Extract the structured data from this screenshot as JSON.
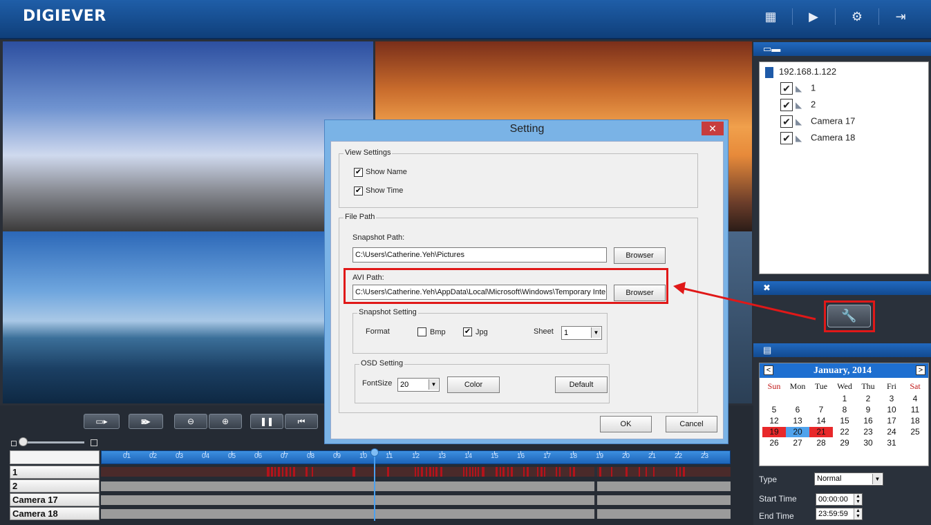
{
  "app": {
    "brand": "DIGIEVER",
    "header_icons": [
      "grid-view-icon",
      "playback-icon",
      "settings-gear-icon",
      "logout-icon"
    ]
  },
  "video": {
    "tiles": [
      "camera-view-1",
      "camera-view-2",
      "camera-view-3",
      "camera-view-4"
    ]
  },
  "controls": {
    "buttons": [
      "record-folder-icon",
      "snapshot-folder-icon",
      "zoom-out-icon",
      "zoom-in-icon",
      "pause-icon",
      "step-back-icon"
    ]
  },
  "timeline": {
    "hours": [
      "01",
      "02",
      "03",
      "04",
      "05",
      "06",
      "07",
      "08",
      "09",
      "10",
      "11",
      "12",
      "13",
      "14",
      "15",
      "16",
      "17",
      "18",
      "19",
      "20",
      "21",
      "22",
      "23"
    ],
    "rows": [
      {
        "label": "1"
      },
      {
        "label": "2"
      },
      {
        "label": "Camera 17"
      },
      {
        "label": "Camera 18"
      }
    ]
  },
  "device_panel": {
    "ip": "192.168.1.122",
    "cameras": [
      {
        "name": "1",
        "checked": "✔"
      },
      {
        "name": "2",
        "checked": "✔"
      },
      {
        "name": "Camera 17",
        "checked": "✔"
      },
      {
        "name": "Camera 18",
        "checked": "✔"
      }
    ]
  },
  "calendar": {
    "month": "January, 2014",
    "prev": "<",
    "next": ">",
    "dow": [
      "Sun",
      "Mon",
      "Tue",
      "Wed",
      "Thu",
      "Fri",
      "Sat"
    ],
    "weeks": [
      [
        "",
        "",
        "",
        "1",
        "2",
        "3",
        "4"
      ],
      [
        "5",
        "6",
        "7",
        "8",
        "9",
        "10",
        "11"
      ],
      [
        "12",
        "13",
        "14",
        "15",
        "16",
        "17",
        "18"
      ],
      [
        "19",
        "20",
        "21",
        "22",
        "23",
        "24",
        "25"
      ],
      [
        "26",
        "27",
        "28",
        "29",
        "30",
        "31",
        ""
      ]
    ]
  },
  "search": {
    "type_label": "Type",
    "type_value": "Normal",
    "start_label": "Start Time",
    "start_value": "00:00:00",
    "end_label": "End Time",
    "end_value": "23:59:59"
  },
  "dialog": {
    "title": "Setting",
    "close": "✕",
    "view_settings": {
      "legend": "View Settings",
      "show_name": "Show Name",
      "show_time": "Show Time",
      "show_name_checked": "✔",
      "show_time_checked": "✔"
    },
    "file_path": {
      "legend": "File Path",
      "snapshot_label": "Snapshot Path:",
      "snapshot_value": "C:\\Users\\Catherine.Yeh\\Pictures",
      "browser": "Browser",
      "avi_label": "AVI Path:",
      "avi_value": "C:\\Users\\Catherine.Yeh\\AppData\\Local\\Microsoft\\Windows\\Temporary Inte",
      "browser2": "Browser"
    },
    "snapshot_setting": {
      "legend": "Snapshot Setting",
      "format": "Format",
      "bmp": "Bmp",
      "jpg": "Jpg",
      "jpg_checked": "✔",
      "sheet": "Sheet",
      "sheet_value": "1"
    },
    "osd_setting": {
      "legend": "OSD Setting",
      "fontsize": "FontSize",
      "fontsize_value": "20",
      "color": "Color",
      "default": "Default"
    },
    "ok": "OK",
    "cancel": "Cancel"
  }
}
